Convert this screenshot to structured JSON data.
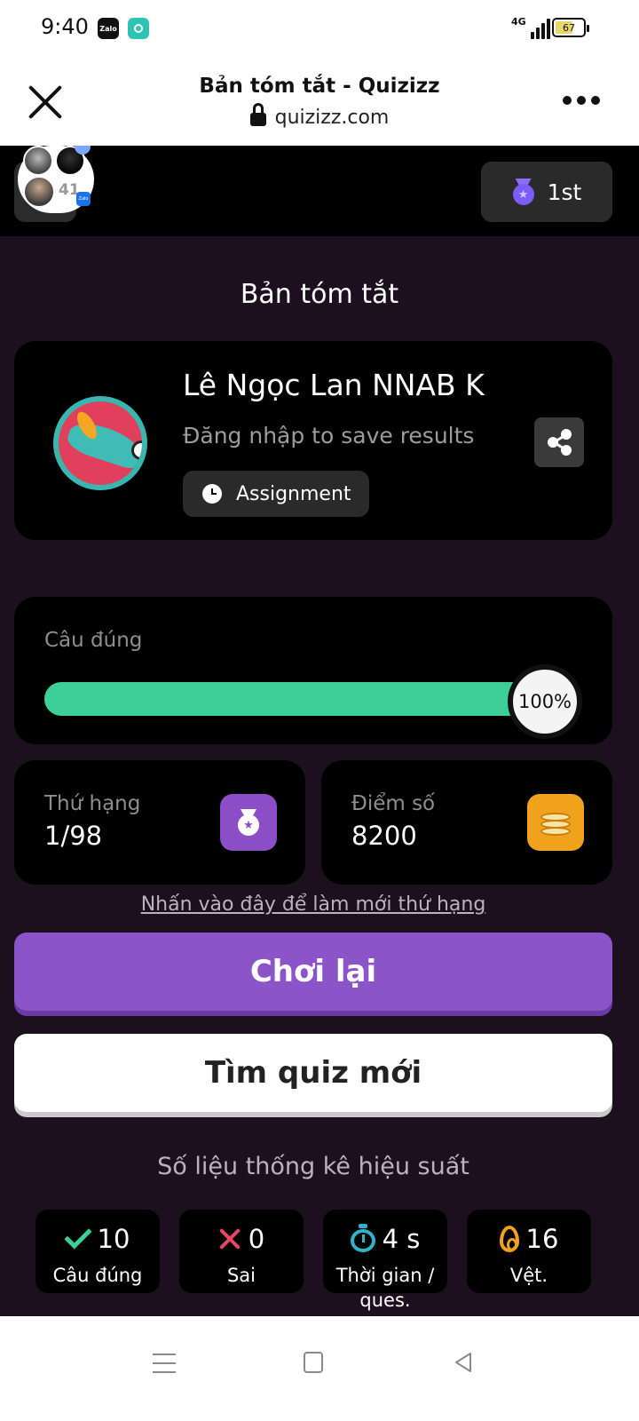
{
  "status_bar": {
    "time": "9:40",
    "zalo_label": "Zalo",
    "network": "4G",
    "battery": "67",
    "battery_level": 0.67
  },
  "browser": {
    "title": "Bản tóm tắt - Quizizz",
    "url": "quizizz.com"
  },
  "chat_head": {
    "count": "41",
    "app_label": "Zalo"
  },
  "header": {
    "rank_badge": "1st"
  },
  "summary": {
    "title": "Bản tóm tắt"
  },
  "player": {
    "name": "Lê Ngọc Lan NNAB K",
    "login_hint": "Đăng nhập to save results",
    "mode_label": "Assignment"
  },
  "accuracy": {
    "label": "Câu đúng",
    "percent_text": "100%",
    "percent": 100
  },
  "stats": {
    "rank_label": "Thứ hạng",
    "rank_value": "1/98",
    "score_label": "Điểm số",
    "score_value": "8200"
  },
  "refresh_link": "Nhấn vào đây để làm mới thứ hạng",
  "buttons": {
    "play_again": "Chơi lại",
    "find_quiz": "Tìm quiz mới"
  },
  "performance": {
    "title": "Số liệu thống kê hiệu suất",
    "tiles": [
      {
        "value": "10",
        "caption": "Câu đúng",
        "icon": "check-icon"
      },
      {
        "value": "0",
        "caption": "Sai",
        "icon": "x-icon"
      },
      {
        "value": "4 s",
        "caption": "Thời gian / ques.",
        "icon": "timer-icon"
      },
      {
        "value": "16",
        "caption": "Vệt.",
        "icon": "flame-icon"
      }
    ]
  },
  "colors": {
    "app_background": "#1d0f1f",
    "card": "#000000",
    "progress_green": "#3ccf98",
    "play_again": "#8b54c8",
    "rank_icon": "#8b4ec6",
    "score_icon": "#f0a21d",
    "wrong_red": "#e54863",
    "timer_teal": "#2fb3c6"
  }
}
